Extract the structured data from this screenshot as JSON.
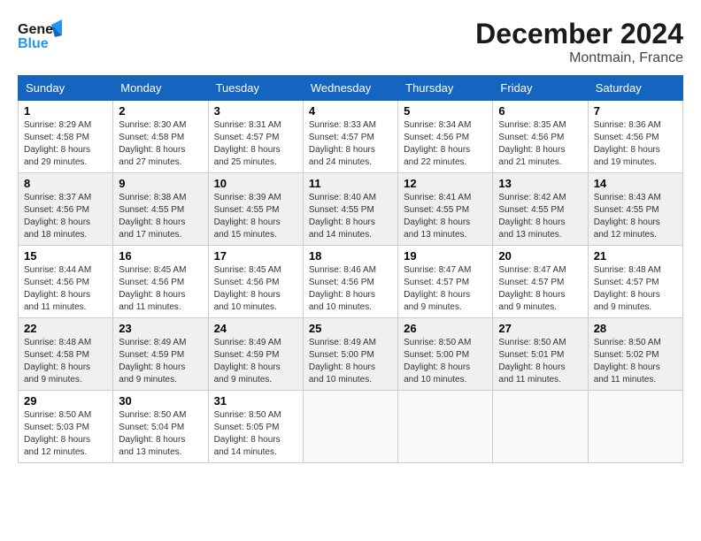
{
  "logo": {
    "line1": "General",
    "line2": "Blue"
  },
  "title": "December 2024",
  "location": "Montmain, France",
  "headers": [
    "Sunday",
    "Monday",
    "Tuesday",
    "Wednesday",
    "Thursday",
    "Friday",
    "Saturday"
  ],
  "weeks": [
    [
      {
        "day": "1",
        "sunrise": "8:29 AM",
        "sunset": "4:58 PM",
        "daylight": "8 hours and 29 minutes."
      },
      {
        "day": "2",
        "sunrise": "8:30 AM",
        "sunset": "4:58 PM",
        "daylight": "8 hours and 27 minutes."
      },
      {
        "day": "3",
        "sunrise": "8:31 AM",
        "sunset": "4:57 PM",
        "daylight": "8 hours and 25 minutes."
      },
      {
        "day": "4",
        "sunrise": "8:33 AM",
        "sunset": "4:57 PM",
        "daylight": "8 hours and 24 minutes."
      },
      {
        "day": "5",
        "sunrise": "8:34 AM",
        "sunset": "4:56 PM",
        "daylight": "8 hours and 22 minutes."
      },
      {
        "day": "6",
        "sunrise": "8:35 AM",
        "sunset": "4:56 PM",
        "daylight": "8 hours and 21 minutes."
      },
      {
        "day": "7",
        "sunrise": "8:36 AM",
        "sunset": "4:56 PM",
        "daylight": "8 hours and 19 minutes."
      }
    ],
    [
      {
        "day": "8",
        "sunrise": "8:37 AM",
        "sunset": "4:56 PM",
        "daylight": "8 hours and 18 minutes."
      },
      {
        "day": "9",
        "sunrise": "8:38 AM",
        "sunset": "4:55 PM",
        "daylight": "8 hours and 17 minutes."
      },
      {
        "day": "10",
        "sunrise": "8:39 AM",
        "sunset": "4:55 PM",
        "daylight": "8 hours and 15 minutes."
      },
      {
        "day": "11",
        "sunrise": "8:40 AM",
        "sunset": "4:55 PM",
        "daylight": "8 hours and 14 minutes."
      },
      {
        "day": "12",
        "sunrise": "8:41 AM",
        "sunset": "4:55 PM",
        "daylight": "8 hours and 13 minutes."
      },
      {
        "day": "13",
        "sunrise": "8:42 AM",
        "sunset": "4:55 PM",
        "daylight": "8 hours and 13 minutes."
      },
      {
        "day": "14",
        "sunrise": "8:43 AM",
        "sunset": "4:55 PM",
        "daylight": "8 hours and 12 minutes."
      }
    ],
    [
      {
        "day": "15",
        "sunrise": "8:44 AM",
        "sunset": "4:56 PM",
        "daylight": "8 hours and 11 minutes."
      },
      {
        "day": "16",
        "sunrise": "8:45 AM",
        "sunset": "4:56 PM",
        "daylight": "8 hours and 11 minutes."
      },
      {
        "day": "17",
        "sunrise": "8:45 AM",
        "sunset": "4:56 PM",
        "daylight": "8 hours and 10 minutes."
      },
      {
        "day": "18",
        "sunrise": "8:46 AM",
        "sunset": "4:56 PM",
        "daylight": "8 hours and 10 minutes."
      },
      {
        "day": "19",
        "sunrise": "8:47 AM",
        "sunset": "4:57 PM",
        "daylight": "8 hours and 9 minutes."
      },
      {
        "day": "20",
        "sunrise": "8:47 AM",
        "sunset": "4:57 PM",
        "daylight": "8 hours and 9 minutes."
      },
      {
        "day": "21",
        "sunrise": "8:48 AM",
        "sunset": "4:57 PM",
        "daylight": "8 hours and 9 minutes."
      }
    ],
    [
      {
        "day": "22",
        "sunrise": "8:48 AM",
        "sunset": "4:58 PM",
        "daylight": "8 hours and 9 minutes."
      },
      {
        "day": "23",
        "sunrise": "8:49 AM",
        "sunset": "4:59 PM",
        "daylight": "8 hours and 9 minutes."
      },
      {
        "day": "24",
        "sunrise": "8:49 AM",
        "sunset": "4:59 PM",
        "daylight": "8 hours and 9 minutes."
      },
      {
        "day": "25",
        "sunrise": "8:49 AM",
        "sunset": "5:00 PM",
        "daylight": "8 hours and 10 minutes."
      },
      {
        "day": "26",
        "sunrise": "8:50 AM",
        "sunset": "5:00 PM",
        "daylight": "8 hours and 10 minutes."
      },
      {
        "day": "27",
        "sunrise": "8:50 AM",
        "sunset": "5:01 PM",
        "daylight": "8 hours and 11 minutes."
      },
      {
        "day": "28",
        "sunrise": "8:50 AM",
        "sunset": "5:02 PM",
        "daylight": "8 hours and 11 minutes."
      }
    ],
    [
      {
        "day": "29",
        "sunrise": "8:50 AM",
        "sunset": "5:03 PM",
        "daylight": "8 hours and 12 minutes."
      },
      {
        "day": "30",
        "sunrise": "8:50 AM",
        "sunset": "5:04 PM",
        "daylight": "8 hours and 13 minutes."
      },
      {
        "day": "31",
        "sunrise": "8:50 AM",
        "sunset": "5:05 PM",
        "daylight": "8 hours and 14 minutes."
      },
      null,
      null,
      null,
      null
    ]
  ],
  "labels": {
    "sunrise": "Sunrise:",
    "sunset": "Sunset:",
    "daylight": "Daylight:"
  }
}
